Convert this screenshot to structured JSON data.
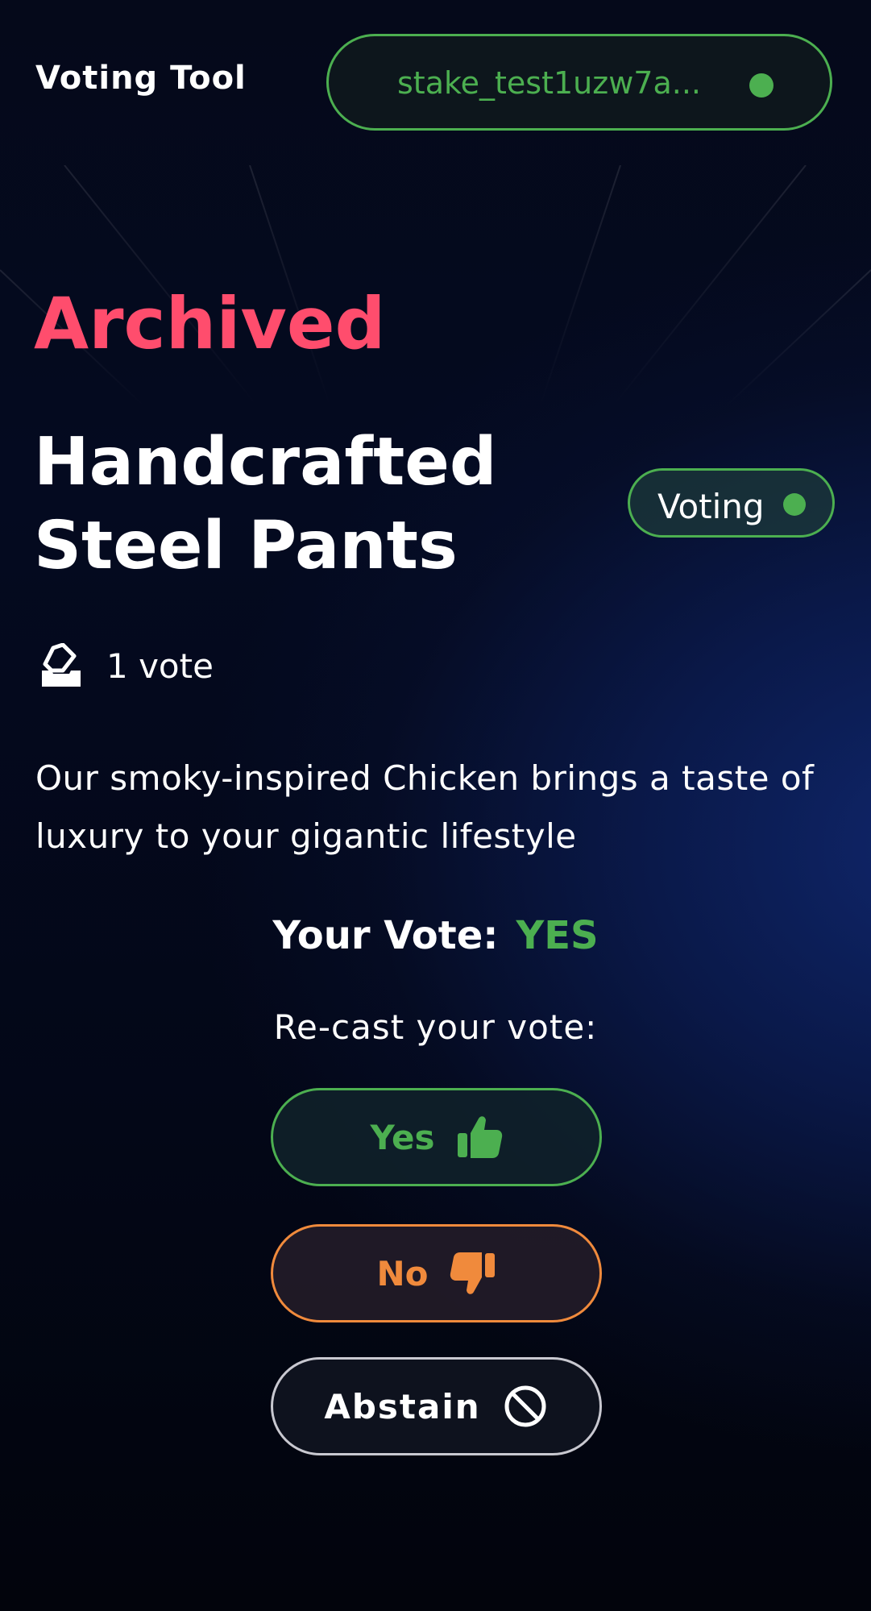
{
  "header": {
    "app_title": "Voting Tool",
    "wallet_address": "stake_test1uzw7a...",
    "wallet_status_color": "#4caf50"
  },
  "proposal": {
    "archive_label": "Archived",
    "title": "Handcrafted Steel Pants",
    "status": "Voting",
    "status_color": "#4caf50",
    "vote_count": "1 vote",
    "description": "Our smoky-inspired Chicken brings a taste of luxury to your gigantic lifestyle"
  },
  "my_vote": {
    "label": "Your Vote:",
    "value": "YES",
    "recast_label": "Re-cast your vote:"
  },
  "buttons": {
    "yes": "Yes",
    "no": "No",
    "abstain": "Abstain"
  },
  "colors": {
    "accent_green": "#4caf50",
    "archived_red": "#ff4d6d",
    "no_orange": "#f08a3c"
  },
  "icons": {
    "vote_count": "ballot-box-icon",
    "yes": "thumbs-up-icon",
    "no": "thumbs-down-icon",
    "abstain": "ban-icon"
  }
}
